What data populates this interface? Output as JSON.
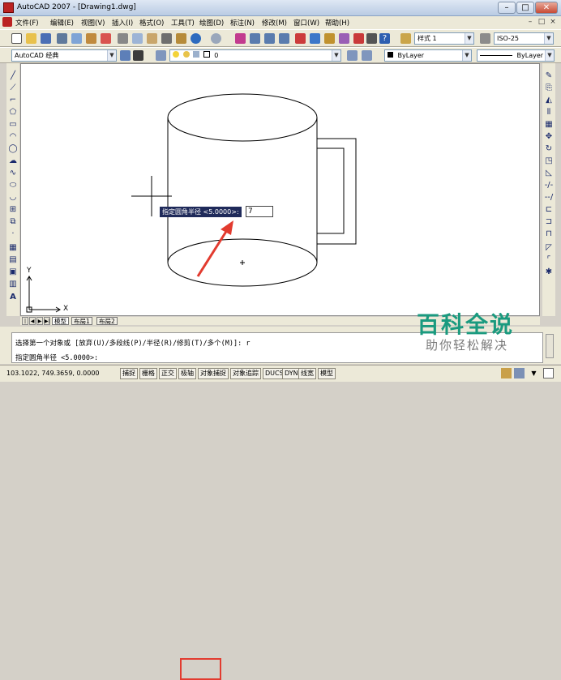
{
  "window": {
    "title": "AutoCAD 2007 - [Drawing1.dwg]"
  },
  "menu": [
    "文件(F)",
    "编辑(E)",
    "视图(V)",
    "插入(I)",
    "格式(O)",
    "工具(T)",
    "绘图(D)",
    "标注(N)",
    "修改(M)",
    "窗口(W)",
    "帮助(H)"
  ],
  "toolbar": {
    "text_style": "样式 1",
    "dim_style": "ISO-25",
    "workspace": "AutoCAD 经典",
    "layer": "0",
    "color": "ByLayer",
    "linetype": "ByLayer"
  },
  "tabs": [
    "模型",
    "布局1",
    "布局2"
  ],
  "tooltip": {
    "prompt": "指定圆角半径 <5.0000>:",
    "input_value": "7"
  },
  "command": {
    "line1": "选择第一个对象或 [放弃(U)/多段线(P)/半径(R)/修剪(T)/多个(M)]: r",
    "line2": "指定圆角半径 <5.0000>:"
  },
  "status": {
    "coords": "103.1022, 749.3659, 0.0000",
    "buttons": [
      "捕捉",
      "栅格",
      "正交",
      "极轴",
      "对象捕捉",
      "对象追踪",
      "DUCS",
      "DYN",
      "线宽",
      "模型"
    ]
  },
  "ucs": {
    "x_label": "X",
    "y_label": "Y"
  },
  "watermark": {
    "main": "百科全说",
    "sub": "助你轻松解决"
  },
  "colors": {
    "annotation": "#e23b2f",
    "tooltip_bg": "#1f2a5a",
    "watermark": "#1a9a7f"
  }
}
